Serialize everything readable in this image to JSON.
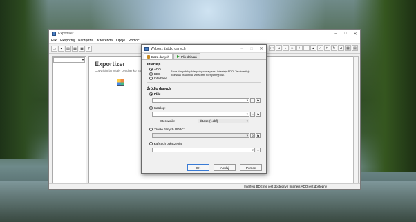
{
  "main_window": {
    "title": "Exportizer",
    "menu": [
      "Plik",
      "Eksportuj",
      "Narzędzia",
      "Kwerenda",
      "Opcje",
      "Pomoc"
    ],
    "brand_name": "Exportizer",
    "brand_sub": "Copyright by Vitaly Levchenko Software",
    "status": "Interfejs BDE nie jest dostępny / Interfejs ADO jest dostępny"
  },
  "dialog": {
    "title": "Wybierz źródło danych",
    "tabs": [
      "Baza danych",
      "Plik działań"
    ],
    "interface_label": "Interfejs",
    "interfaces": [
      "ADO",
      "BDE",
      "Interbase"
    ],
    "interface_selected": "ADO",
    "interface_description": "Baza danych będzie połączona przez interfejs ADO. Ten interfejs pozwala pracować z bazami różnych typów.",
    "source_label": "Źródło danych",
    "source_file": "Plik:",
    "source_folder": "Katalog:",
    "driver_label": "Sterownik:",
    "driver_value": "dBase (*.dbf)",
    "source_odbc": "Źródło danych ODBC:",
    "source_connstr": "Łańcuch połączenia:",
    "source_selected": "Plik:",
    "ellipsis": "...",
    "buttons": {
      "ok": "OK",
      "cancel": "Anuluj",
      "help": "Pomoc"
    }
  }
}
